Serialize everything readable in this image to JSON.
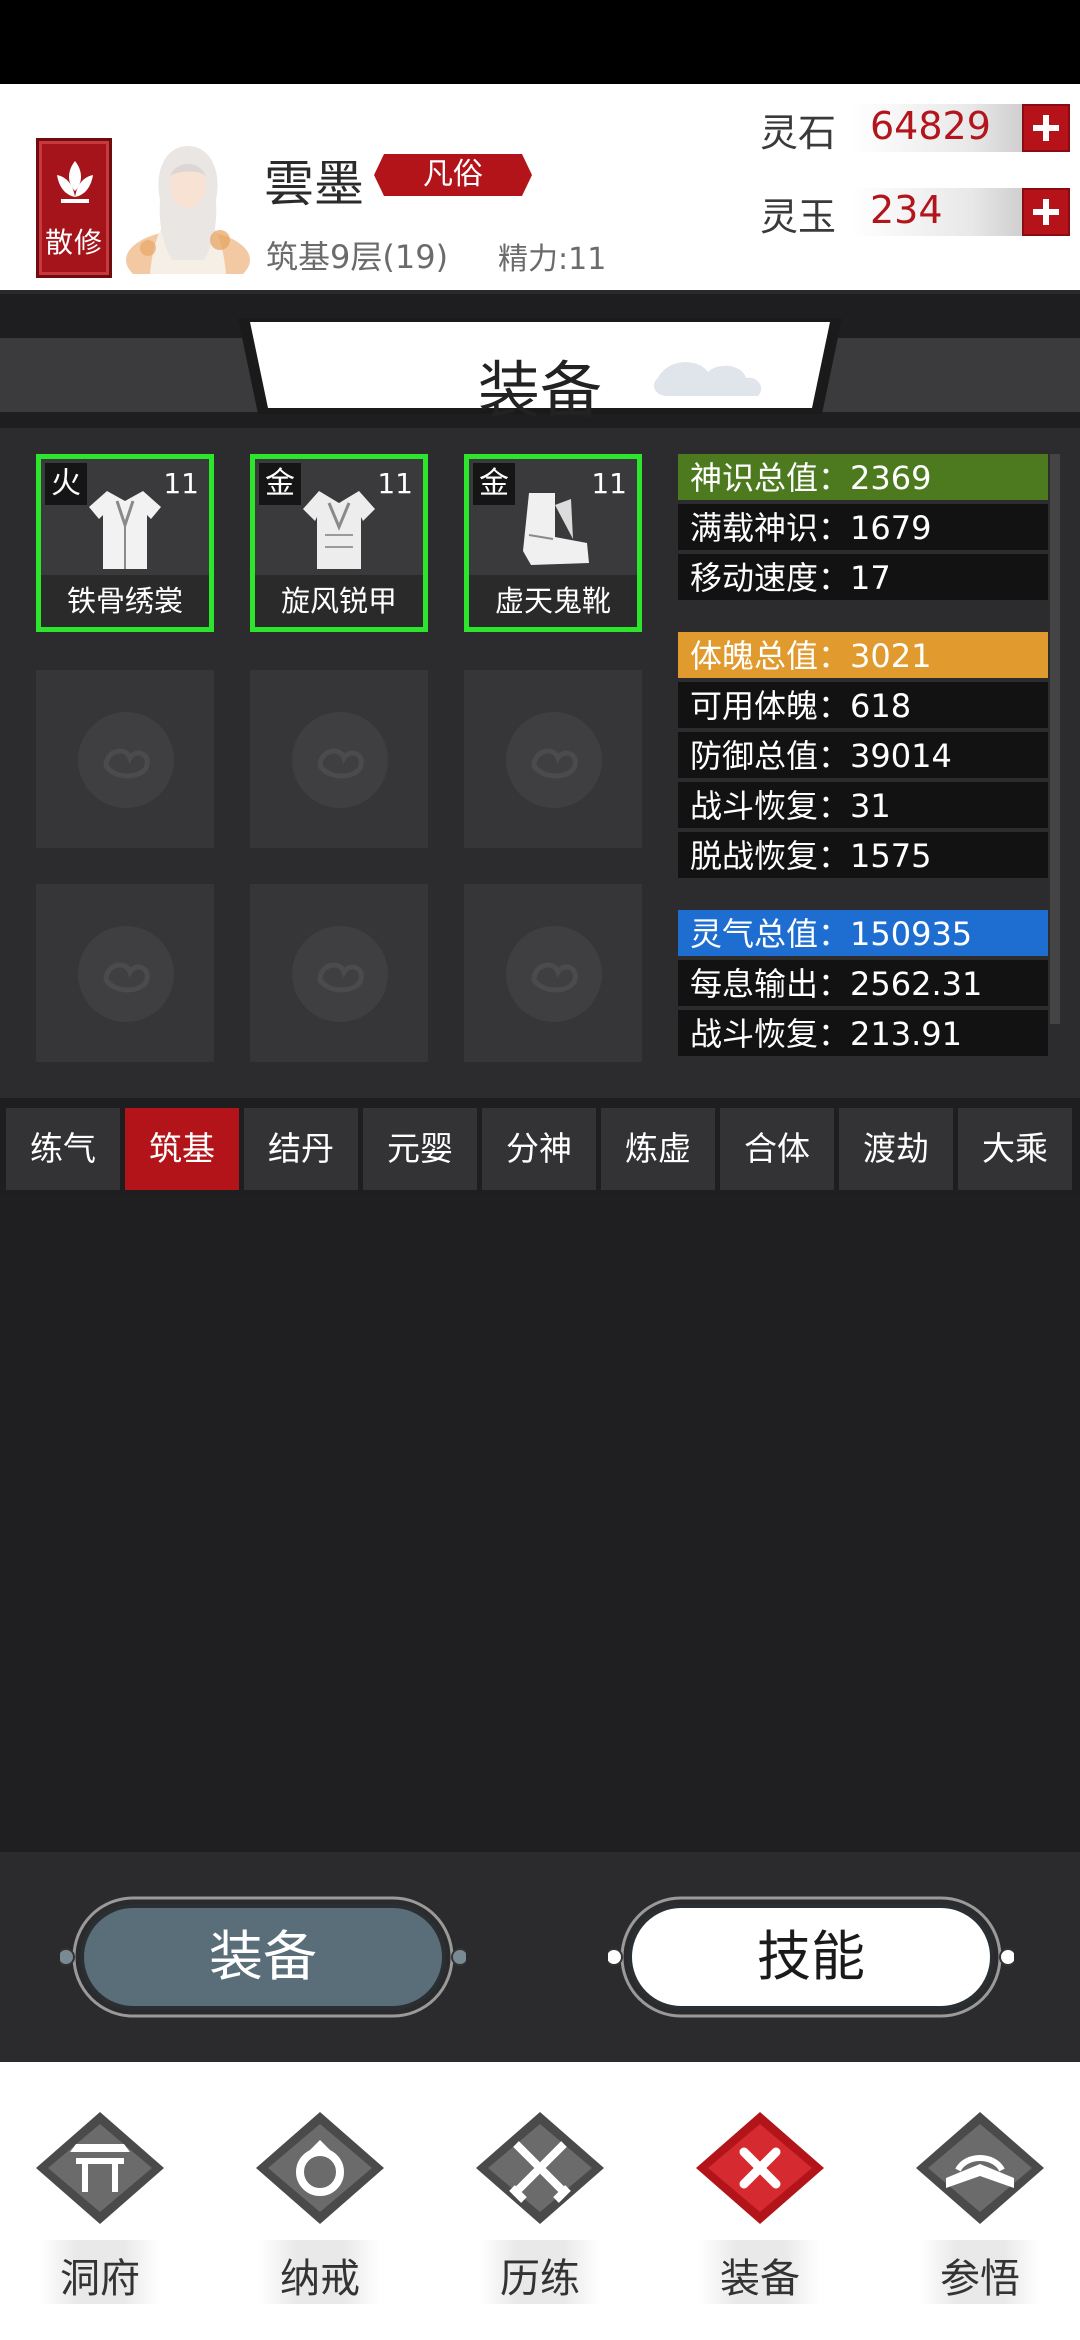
{
  "header": {
    "sect_label": "散修",
    "player_name": "雲墨",
    "rank_label": "凡俗",
    "realm_text": "筑基9层(19)",
    "energy_text": "精力:11",
    "currencies": [
      {
        "label": "灵石",
        "value": "64829"
      },
      {
        "label": "灵玉",
        "value": "234"
      }
    ]
  },
  "banner": {
    "title": "装备"
  },
  "equipment": {
    "slots": [
      {
        "element": "火",
        "level": "11",
        "name": "铁骨绣裳",
        "icon": "robe-icon"
      },
      {
        "element": "金",
        "level": "11",
        "name": "旋风锐甲",
        "icon": "armor-icon"
      },
      {
        "element": "金",
        "level": "11",
        "name": "虚天鬼靴",
        "icon": "boots-icon"
      }
    ],
    "empty_slot_icon": "cloud-emblem-icon"
  },
  "stats": {
    "spirit_sense": {
      "header": "神识总值：2369",
      "rows": [
        "满载神识：1679",
        "移动速度：17"
      ]
    },
    "body": {
      "header": "体魄总值：3021",
      "rows": [
        "可用体魄：618",
        "防御总值：39014",
        "战斗恢复：31",
        "脱战恢复：1575"
      ]
    },
    "qi": {
      "header": "灵气总值：150935",
      "rows": [
        "每息输出：2562.31",
        "战斗恢复：213.91"
      ]
    }
  },
  "realm_tabs": [
    "练气",
    "筑基",
    "结丹",
    "元婴",
    "分神",
    "炼虚",
    "合体",
    "渡劫",
    "大乘"
  ],
  "active_realm": "筑基",
  "actions": {
    "equip_label": "装备",
    "skill_label": "技能"
  },
  "nav": [
    {
      "label": "洞府",
      "icon": "gate-icon"
    },
    {
      "label": "纳戒",
      "icon": "ring-icon"
    },
    {
      "label": "历练",
      "icon": "crossed-swords-icon"
    },
    {
      "label": "装备",
      "icon": "close-x-icon"
    },
    {
      "label": "参悟",
      "icon": "book-icon"
    }
  ],
  "colors": {
    "accent_red": "#b3141a",
    "slot_border_green": "#2ee52e",
    "stat_green": "#4d7a1f",
    "stat_orange": "#e09a2e",
    "stat_blue": "#1e6ed2"
  }
}
